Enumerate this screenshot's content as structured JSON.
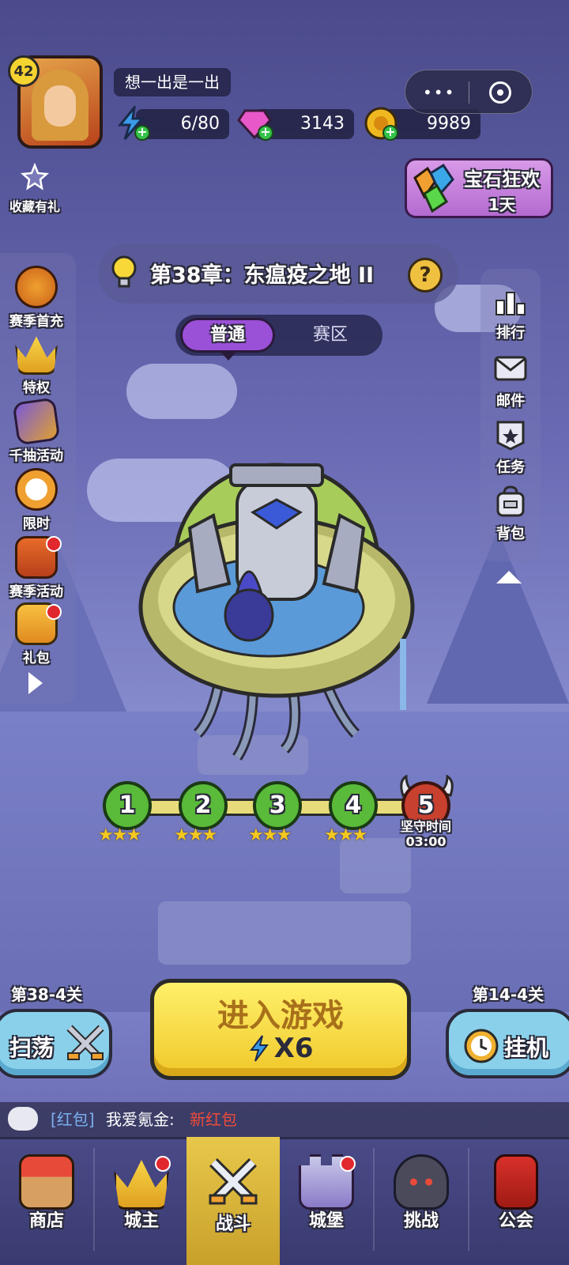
{
  "profile": {
    "level": "42",
    "username": "想一出是一出"
  },
  "resources": {
    "energy": {
      "value": "6/80",
      "icon": "lightning-icon"
    },
    "gems": {
      "value": "3143",
      "icon": "gem-icon"
    },
    "gold": {
      "value": "9989",
      "icon": "coin-icon"
    }
  },
  "left_menu": [
    {
      "label": "收藏有礼",
      "icon": "star-icon"
    },
    {
      "label": "赛季首充",
      "icon": "first-charge-icon"
    },
    {
      "label": "特权",
      "icon": "crown-icon"
    },
    {
      "label": "千抽活动",
      "icon": "cards-icon"
    },
    {
      "label": "限时",
      "icon": "alarm-clock-icon"
    },
    {
      "label": "赛季活动",
      "icon": "treasure-chest-icon"
    },
    {
      "label": "礼包",
      "icon": "gift-icon"
    }
  ],
  "gem_event": {
    "title": "宝石狂欢",
    "duration": "1天"
  },
  "chapter": {
    "title": "第38章：东瘟疫之地 II",
    "help": "?"
  },
  "mode_tabs": {
    "active": "普通",
    "other": "赛区"
  },
  "right_menu": [
    {
      "label": "排行",
      "icon": "ranking-icon"
    },
    {
      "label": "邮件",
      "icon": "mail-icon"
    },
    {
      "label": "任务",
      "icon": "task-icon"
    },
    {
      "label": "背包",
      "icon": "backpack-icon"
    }
  ],
  "stages": [
    {
      "number": "1",
      "stars": "★★★"
    },
    {
      "number": "2",
      "stars": "★★★"
    },
    {
      "number": "3",
      "stars": "★★★"
    },
    {
      "number": "4",
      "stars": "★★★"
    },
    {
      "number": "5",
      "label": "坚守时间",
      "time": "03:00"
    }
  ],
  "actions": {
    "sweep": {
      "stage": "第38-4关",
      "label": "扫荡"
    },
    "enter": {
      "label": "进入游戏",
      "cost": "X6"
    },
    "idle": {
      "stage": "第14-4关",
      "label": "挂机"
    }
  },
  "chat": {
    "tag": "[红包]",
    "sender": "我爱氪金:",
    "message": "新红包"
  },
  "bottom_nav": [
    {
      "label": "商店",
      "icon": "shop-icon"
    },
    {
      "label": "城主",
      "icon": "lord-crown-icon"
    },
    {
      "label": "战斗",
      "icon": "crossed-swords-icon"
    },
    {
      "label": "城堡",
      "icon": "castle-icon"
    },
    {
      "label": "挑战",
      "icon": "demon-icon"
    },
    {
      "label": "公会",
      "icon": "guild-banner-icon"
    }
  ]
}
